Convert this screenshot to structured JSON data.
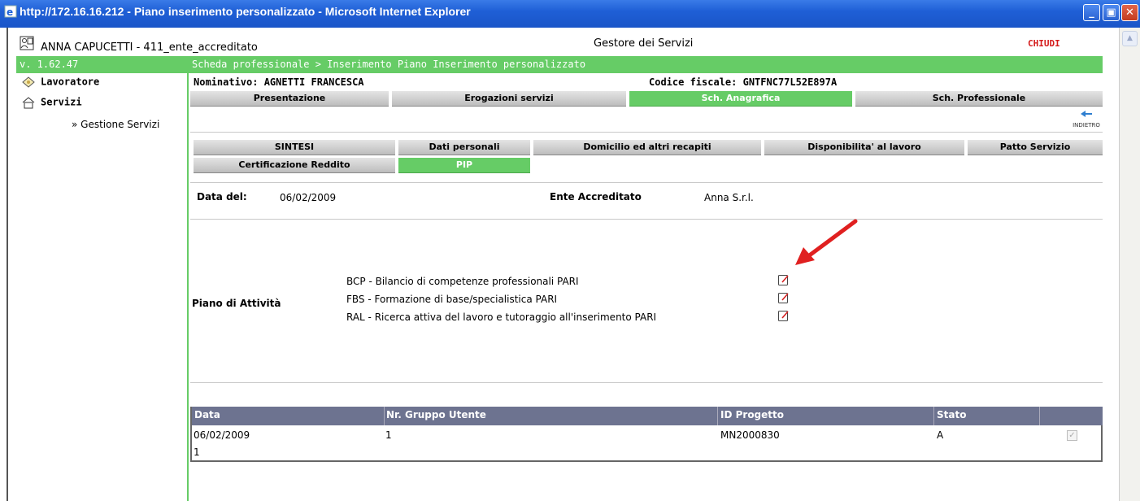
{
  "window": {
    "title": "http://172.16.16.212 - Piano inserimento personalizzato - Microsoft Internet Explorer",
    "minimize": "_",
    "maximize": "▣",
    "close": "✕"
  },
  "header": {
    "user": "ANNA CAPUCETTI - 411_ente_accreditato",
    "app_title": "Gestore dei Servizi",
    "close_label": "CHIUDI"
  },
  "greenbar": {
    "version": "v. 1.62.47",
    "breadcrumb": "Scheda professionale > Inserimento Piano Inserimento personalizzato"
  },
  "sidebar": {
    "items": [
      {
        "label": "Lavoratore",
        "icon": "worker-icon"
      },
      {
        "label": "Servizi",
        "icon": "house-icon"
      }
    ],
    "sub_item": "» Gestione Servizi"
  },
  "person": {
    "name_label": "Nominativo: AGNETTI  FRANCESCA",
    "cf_label": "Codice fiscale: GNTFNC77L52E897A"
  },
  "tabs_main": [
    {
      "label": "Presentazione",
      "active": false
    },
    {
      "label": "Erogazioni servizi",
      "active": false
    },
    {
      "label": "Sch. Anagrafica",
      "active": true
    },
    {
      "label": "Sch. Professionale",
      "active": false
    }
  ],
  "back_label": "INDIETRO",
  "tabs_sub": [
    {
      "label": "SINTESI",
      "active": false
    },
    {
      "label": "Dati personali",
      "active": false
    },
    {
      "label": "Domicilio ed altri recapiti",
      "active": false
    },
    {
      "label": "Disponibilita' al lavoro",
      "active": false
    },
    {
      "label": "Patto Servizio",
      "active": false
    },
    {
      "label": "Certificazione Reddito",
      "active": false
    },
    {
      "label": "PIP",
      "active": true
    }
  ],
  "details": {
    "date_label": "Data del:",
    "date_value": "06/02/2009",
    "ente_label": "Ente Accreditato",
    "ente_value": "Anna S.r.l."
  },
  "piano": {
    "label": "Piano di Attività",
    "activities": [
      "BCP - Bilancio di competenze professionali PARI",
      "FBS - Formazione di base/specialistica PARI",
      "RAL - Ricerca attiva del lavoro e tutoraggio all'inserimento PARI"
    ]
  },
  "table": {
    "columns": [
      "Data",
      "Nr. Gruppo Utente",
      "ID Progetto",
      "Stato",
      ""
    ],
    "rows": [
      [
        "06/02/2009",
        "1",
        "MN2000830",
        "A"
      ]
    ],
    "footer": "1"
  },
  "colors": {
    "accent_green": "#66cc66",
    "header_blue": "#1f5fd6",
    "close_red": "#d41a1a",
    "arrow_red": "#e02020"
  }
}
